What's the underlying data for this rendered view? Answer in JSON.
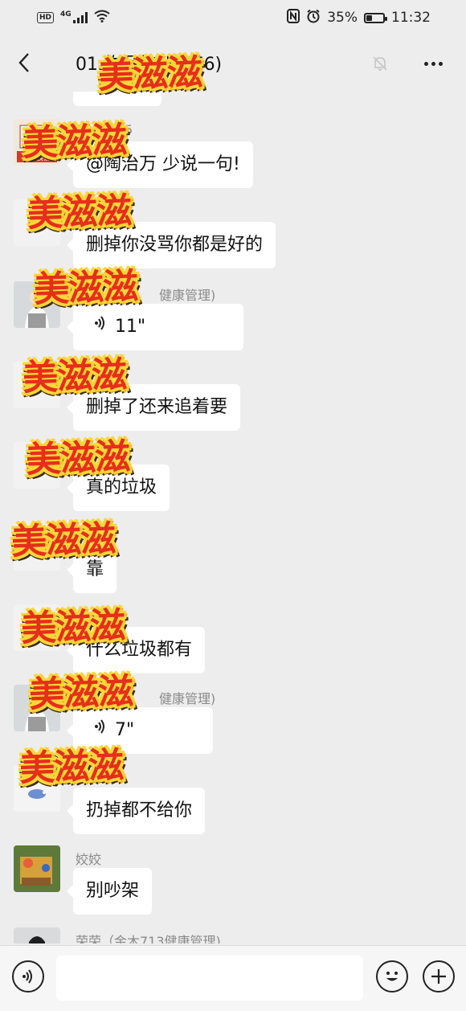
{
  "status_bar": {
    "hd": "HD",
    "network": "4G",
    "battery_percent": "35%",
    "battery_level": 0.35,
    "time": "11:32",
    "icons": [
      "nfc-icon",
      "alarm-icon",
      "wifi-icon"
    ]
  },
  "header": {
    "back_icon": "chevron-left-icon",
    "title": "01              物品转让(476)",
    "more_icon": "ellipsis-icon"
  },
  "messages": [
    {
      "sender": "5844295",
      "text": "@陶治万  少说一句!",
      "type": "text"
    },
    {
      "sender": "",
      "text": "删掉你没骂你都是好的",
      "type": "text"
    },
    {
      "sender": "健康管理)",
      "text": "11\"",
      "type": "voice"
    },
    {
      "sender": "",
      "text": "删掉了还来追着要",
      "type": "text"
    },
    {
      "sender": "",
      "text": "真的垃圾",
      "type": "text"
    },
    {
      "sender": "",
      "text": "靠",
      "type": "text"
    },
    {
      "sender": "",
      "text": "什么垃圾都有",
      "type": "text"
    },
    {
      "sender": "健康管理)",
      "text": "7\"",
      "type": "voice"
    },
    {
      "sender": "",
      "text": "扔掉都不给你",
      "type": "text"
    },
    {
      "sender": "姣姣",
      "text": "别吵架",
      "type": "text"
    },
    {
      "sender": "荣荣（金木713健康管理)",
      "text": "",
      "type": "partial"
    }
  ],
  "stickers": [
    "美滋滋",
    "美滋滋",
    "美滋滋",
    "美滋滋",
    "美滋滋",
    "美滋滋",
    "美滋滋",
    "美滋滋",
    "美滋滋",
    "美滋滋"
  ],
  "input_bar": {
    "placeholder": "",
    "voice_icon": "voice-icon",
    "emoji_icon": "emoji-icon",
    "plus_icon": "plus-icon"
  }
}
